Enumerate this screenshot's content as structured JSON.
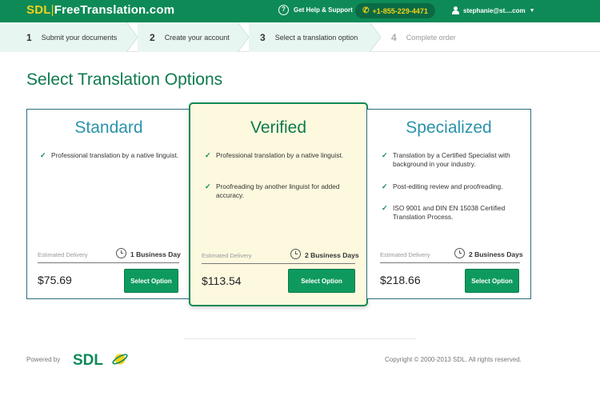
{
  "header": {
    "logo_sdl": "SDL",
    "logo_sep": "|",
    "logo_rest": "FreeTranslation.com",
    "help_label": "Get Help & Support",
    "phone": "+1-855-229-4471",
    "user": "stephanie@st....com",
    "brand_color": "#0e8a57",
    "accent_color": "#f3d21a"
  },
  "steps": [
    {
      "num": "1",
      "label": "Submit your documents"
    },
    {
      "num": "2",
      "label": "Create your account"
    },
    {
      "num": "3",
      "label": "Select a translation option"
    },
    {
      "num": "4",
      "label": "Complete order"
    }
  ],
  "page_title": "Select Translation Options",
  "cards": [
    {
      "title": "Standard",
      "features": [
        "Professional translation by a native linguist."
      ],
      "est_label": "Estimated Delivery",
      "delivery": "1 Business Day",
      "price": "$75.69",
      "button": "Select Option"
    },
    {
      "title": "Verified",
      "features": [
        "Professional translation by a native linguist.",
        "Proofreading by another linguist for added accuracy."
      ],
      "est_label": "Estimated Delivery",
      "delivery": "2 Business Days",
      "price": "$113.54",
      "button": "Select Option",
      "highlighted": true
    },
    {
      "title": "Specialized",
      "features": [
        "Translation by a Certified Specialist with background in your industry.",
        "Post-editing review and proofreading.",
        "ISO 9001 and DIN EN 15038 Certified Translation Process."
      ],
      "est_label": "Estimated Delivery",
      "delivery": "2 Business Days",
      "price": "$218.66",
      "button": "Select Option"
    }
  ],
  "footer": {
    "powered_by": "Powered by",
    "sdl_logo": "SDL",
    "copyright": "Copyright © 2000-2013 SDL. All rights reserved."
  }
}
